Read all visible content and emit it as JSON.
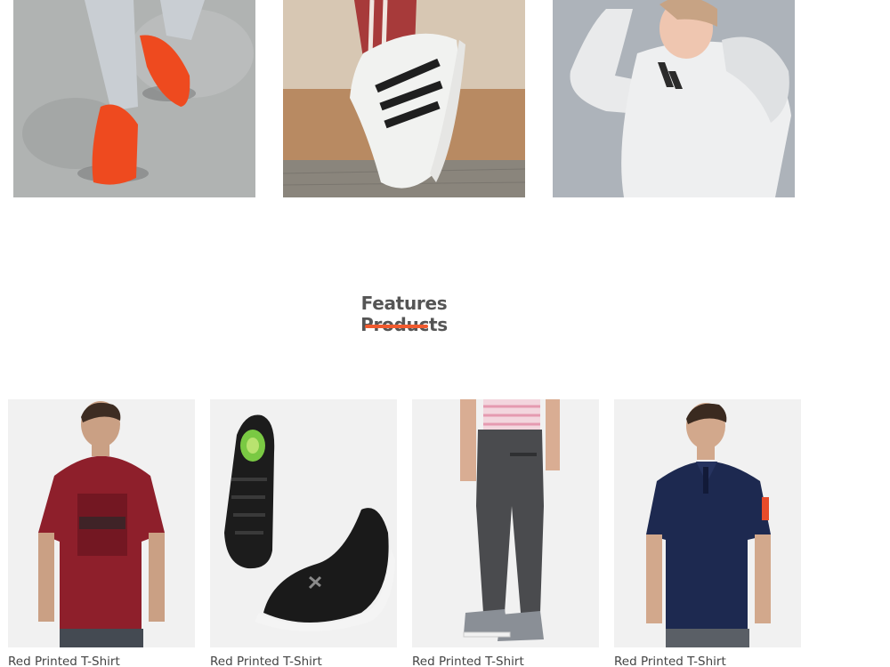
{
  "categories": [
    {
      "name": "orange-sneakers-banner"
    },
    {
      "name": "sneakers-banner"
    },
    {
      "name": "hoodie-banner"
    }
  ],
  "section": {
    "title": "Features Products"
  },
  "colors": {
    "accent": "#f05a2e",
    "title": "#555555",
    "card_bg": "#f1f1f1"
  },
  "products": [
    {
      "name": "Red Printed T-Shirt"
    },
    {
      "name": "Red Printed T-Shirt"
    },
    {
      "name": "Red Printed T-Shirt"
    },
    {
      "name": "Red Printed T-Shirt"
    }
  ]
}
